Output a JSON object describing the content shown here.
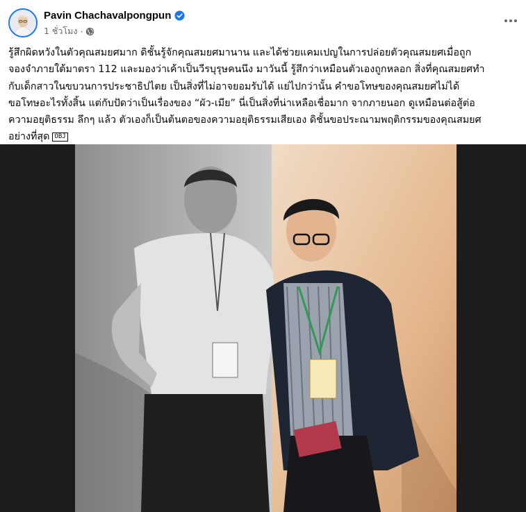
{
  "post": {
    "author": "Pavin Chachavalpongpun",
    "timestamp": "1 ชั่วโมง",
    "meta_separator": "·",
    "privacy_icon": "globe-icon",
    "verified_icon": "verified-badge-icon",
    "more_icon": "more-options-icon",
    "text_lines": [
      "รู้สึกผิดหวังในตัวคุณสมยศมาก ดิชั้นรู้จักคุณสมยศมานาน และได้ช่วยแคมเปญในการปล่อยตัวคุณสมยศเมื่อถูก",
      "จองจำภายใต้มาตรา 112 และมองว่าเค้าเป็นวีรบุรุษคนนึง มาวันนี้ รู้สึกว่าเหมือนตัวเองถูกหลอก สิ่งที่คุณสมยศทำ",
      "กับเด็กสาวในขบวนการประชาธิปไตย เป็นสิ่งที่ไม่อาจยอมรับได้ แย่ไปกว่านั้น คำขอโทษของคุณสมยศไม่ได้",
      "ขอโทษอะไรทั้งสิ้น แต่กับปัดว่าเป็นเรื่องของ “ผัว-เมีย” นี่เป็นสิ่งที่น่าเหลือเชื่อมาก จากภายนอก ดูเหมือนต่อสู้ต่อ",
      "ความอยุติธรรม ลึกๆ แล้ว ตัวเองก็เป็นต้นตอของความอยุติธรรมเสียเอง ดิชั้นขอประณามพฤติกรรมของคุณสมยศ",
      "อย่างที่สุด"
    ],
    "trailing_glyph": "OBJ",
    "colors": {
      "brand": "#1877f2",
      "secondary_text": "#65676b",
      "photo_background": "#1c1c1c"
    }
  }
}
